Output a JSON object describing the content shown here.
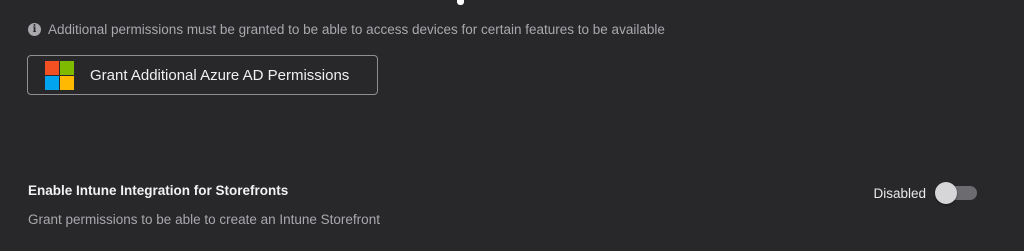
{
  "notice": {
    "icon": "info-icon",
    "icon_glyph": "i",
    "text": "Additional permissions must be granted to be able to access devices for certain features to be available"
  },
  "grant_button": {
    "icon": "microsoft-logo-icon",
    "label": "Grant Additional Azure AD Permissions",
    "logo_colors": [
      "#f25022",
      "#7fba00",
      "#00a4ef",
      "#ffb900"
    ]
  },
  "intune": {
    "title": "Enable Intune Integration for Storefronts",
    "description": "Grant permissions to be able to create an Intune Storefront",
    "toggle_label": "Disabled",
    "enabled": false
  },
  "colors": {
    "background": "#28282b",
    "muted_text": "#a9a9ad",
    "button_border": "#8f8f94"
  }
}
